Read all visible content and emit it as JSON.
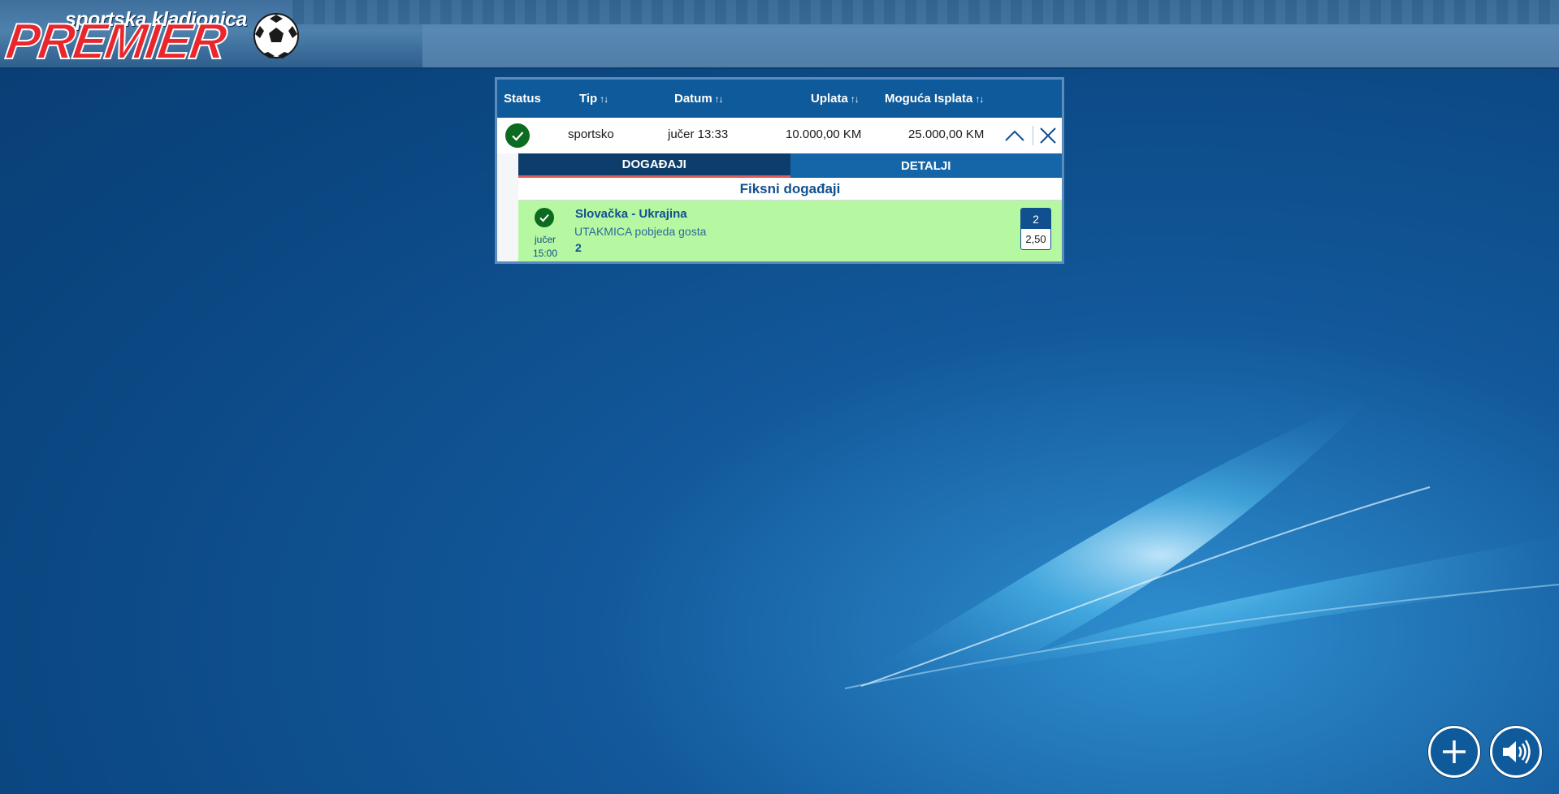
{
  "brand": {
    "small_text": "sportska kladionica",
    "big_text": "PREMIER",
    "accent_red": "#e8262b"
  },
  "table": {
    "headers": [
      {
        "label": "Status",
        "sortable": false
      },
      {
        "label": "Tip",
        "sortable": true,
        "sort_icon": "↑↓"
      },
      {
        "label": "Datum",
        "sortable": true,
        "sort_icon": "↑↓"
      },
      {
        "label": "Uplata",
        "sortable": true,
        "sort_icon": "↑↓"
      },
      {
        "label": "Moguća Isplata",
        "sortable": true,
        "sort_icon": "↑↓"
      }
    ],
    "row": {
      "status_icon": "check-circle-icon",
      "tip": "sportsko",
      "datum": "jučer 13:33",
      "uplata": "10.000,00 KM",
      "isplata": "25.000,00 KM",
      "collapse_icon": "chevron-up-icon",
      "close_icon": "close-icon"
    }
  },
  "detail": {
    "tabs": [
      {
        "label": "DOGAĐAJI",
        "active": true
      },
      {
        "label": "DETALJI",
        "active": false
      }
    ],
    "section_title": "Fiksni događaji",
    "event": {
      "status_icon": "check-circle-icon",
      "when_day": "jučer",
      "when_time": "15:00",
      "teams": "Slovačka - Ukrajina",
      "market": "UTAKMICA pobjeda gosta",
      "pick": "2",
      "odds_selection": "2",
      "odds_value": "2,50",
      "background": "#b6f7a2"
    }
  },
  "actions": {
    "add_icon": "plus-icon",
    "sound_icon": "speaker-icon"
  },
  "colors": {
    "primary": "#0f5a9a",
    "success": "#0b6b1f",
    "tab_active": "#0d3d6b"
  }
}
